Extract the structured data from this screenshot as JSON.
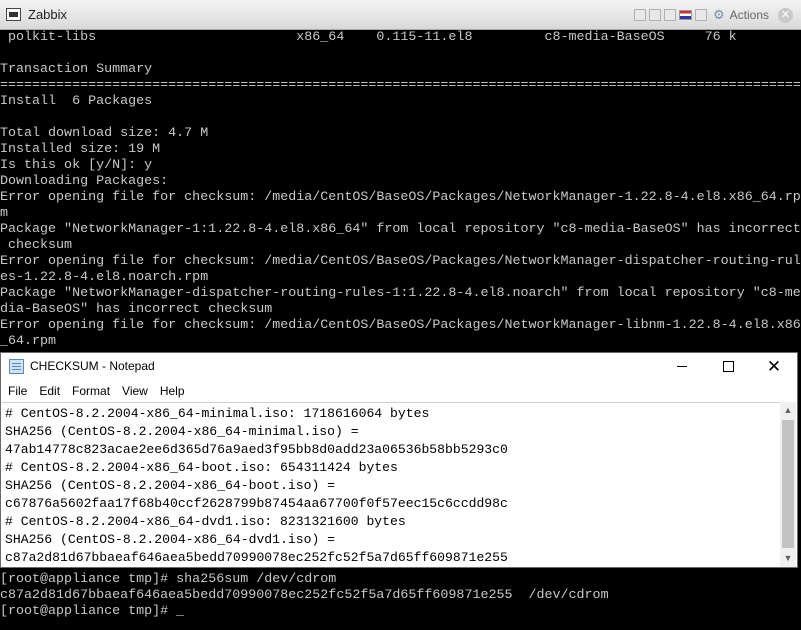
{
  "vm_window": {
    "title": "Zabbix",
    "actions_label": "Actions",
    "close_glyph": "✕"
  },
  "terminal": {
    "lines": [
      " polkit-libs                         x86_64    0.115-11.el8         c8-media-BaseOS     76 k",
      "",
      "Transaction Summary",
      "================================================================================================================",
      "Install  6 Packages",
      "",
      "Total download size: 4.7 M",
      "Installed size: 19 M",
      "Is this ok [y/N]: y",
      "Downloading Packages:",
      "Error opening file for checksum: /media/CentOS/BaseOS/Packages/NetworkManager-1.22.8-4.el8.x86_64.rp",
      "m",
      "Package \"NetworkManager-1:1.22.8-4.el8.x86_64\" from local repository \"c8-media-BaseOS\" has incorrect",
      " checksum",
      "Error opening file for checksum: /media/CentOS/BaseOS/Packages/NetworkManager-dispatcher-routing-rul",
      "es-1.22.8-4.el8.noarch.rpm",
      "Package \"NetworkManager-dispatcher-routing-rules-1:1.22.8-4.el8.noarch\" from local repository \"c8-me",
      "dia-BaseOS\" has incorrect checksum",
      "Error opening file for checksum: /media/CentOS/BaseOS/Packages/NetworkManager-libnm-1.22.8-4.el8.x86",
      "_64.rpm"
    ],
    "bottom_lines": [
      "[root@appliance tmp]# sha256sum /dev/cdrom",
      "c87a2d81d67bbaeaf646aea5bedd70990078ec252fc52f5a7d65ff609871e255  /dev/cdrom",
      "[root@appliance tmp]# _"
    ]
  },
  "notepad": {
    "title": "CHECKSUM - Notepad",
    "menu": [
      "File",
      "Edit",
      "Format",
      "View",
      "Help"
    ],
    "close_glyph": "✕",
    "content": [
      "# CentOS-8.2.2004-x86_64-minimal.iso: 1718616064 bytes",
      "SHA256 (CentOS-8.2.2004-x86_64-minimal.iso) =",
      "47ab14778c823acae2ee6d365d76a9aed3f95bb8d0add23a06536b58bb5293c0",
      "# CentOS-8.2.2004-x86_64-boot.iso: 654311424 bytes",
      "SHA256 (CentOS-8.2.2004-x86_64-boot.iso) =",
      "c67876a5602faa17f68b40ccf2628799b87454aa67700f0f57eec15c6ccdd98c",
      "# CentOS-8.2.2004-x86_64-dvd1.iso: 8231321600 bytes",
      "SHA256 (CentOS-8.2.2004-x86_64-dvd1.iso) =",
      "c87a2d81d67bbaeaf646aea5bedd70990078ec252fc52f5a7d65ff609871e255"
    ]
  }
}
